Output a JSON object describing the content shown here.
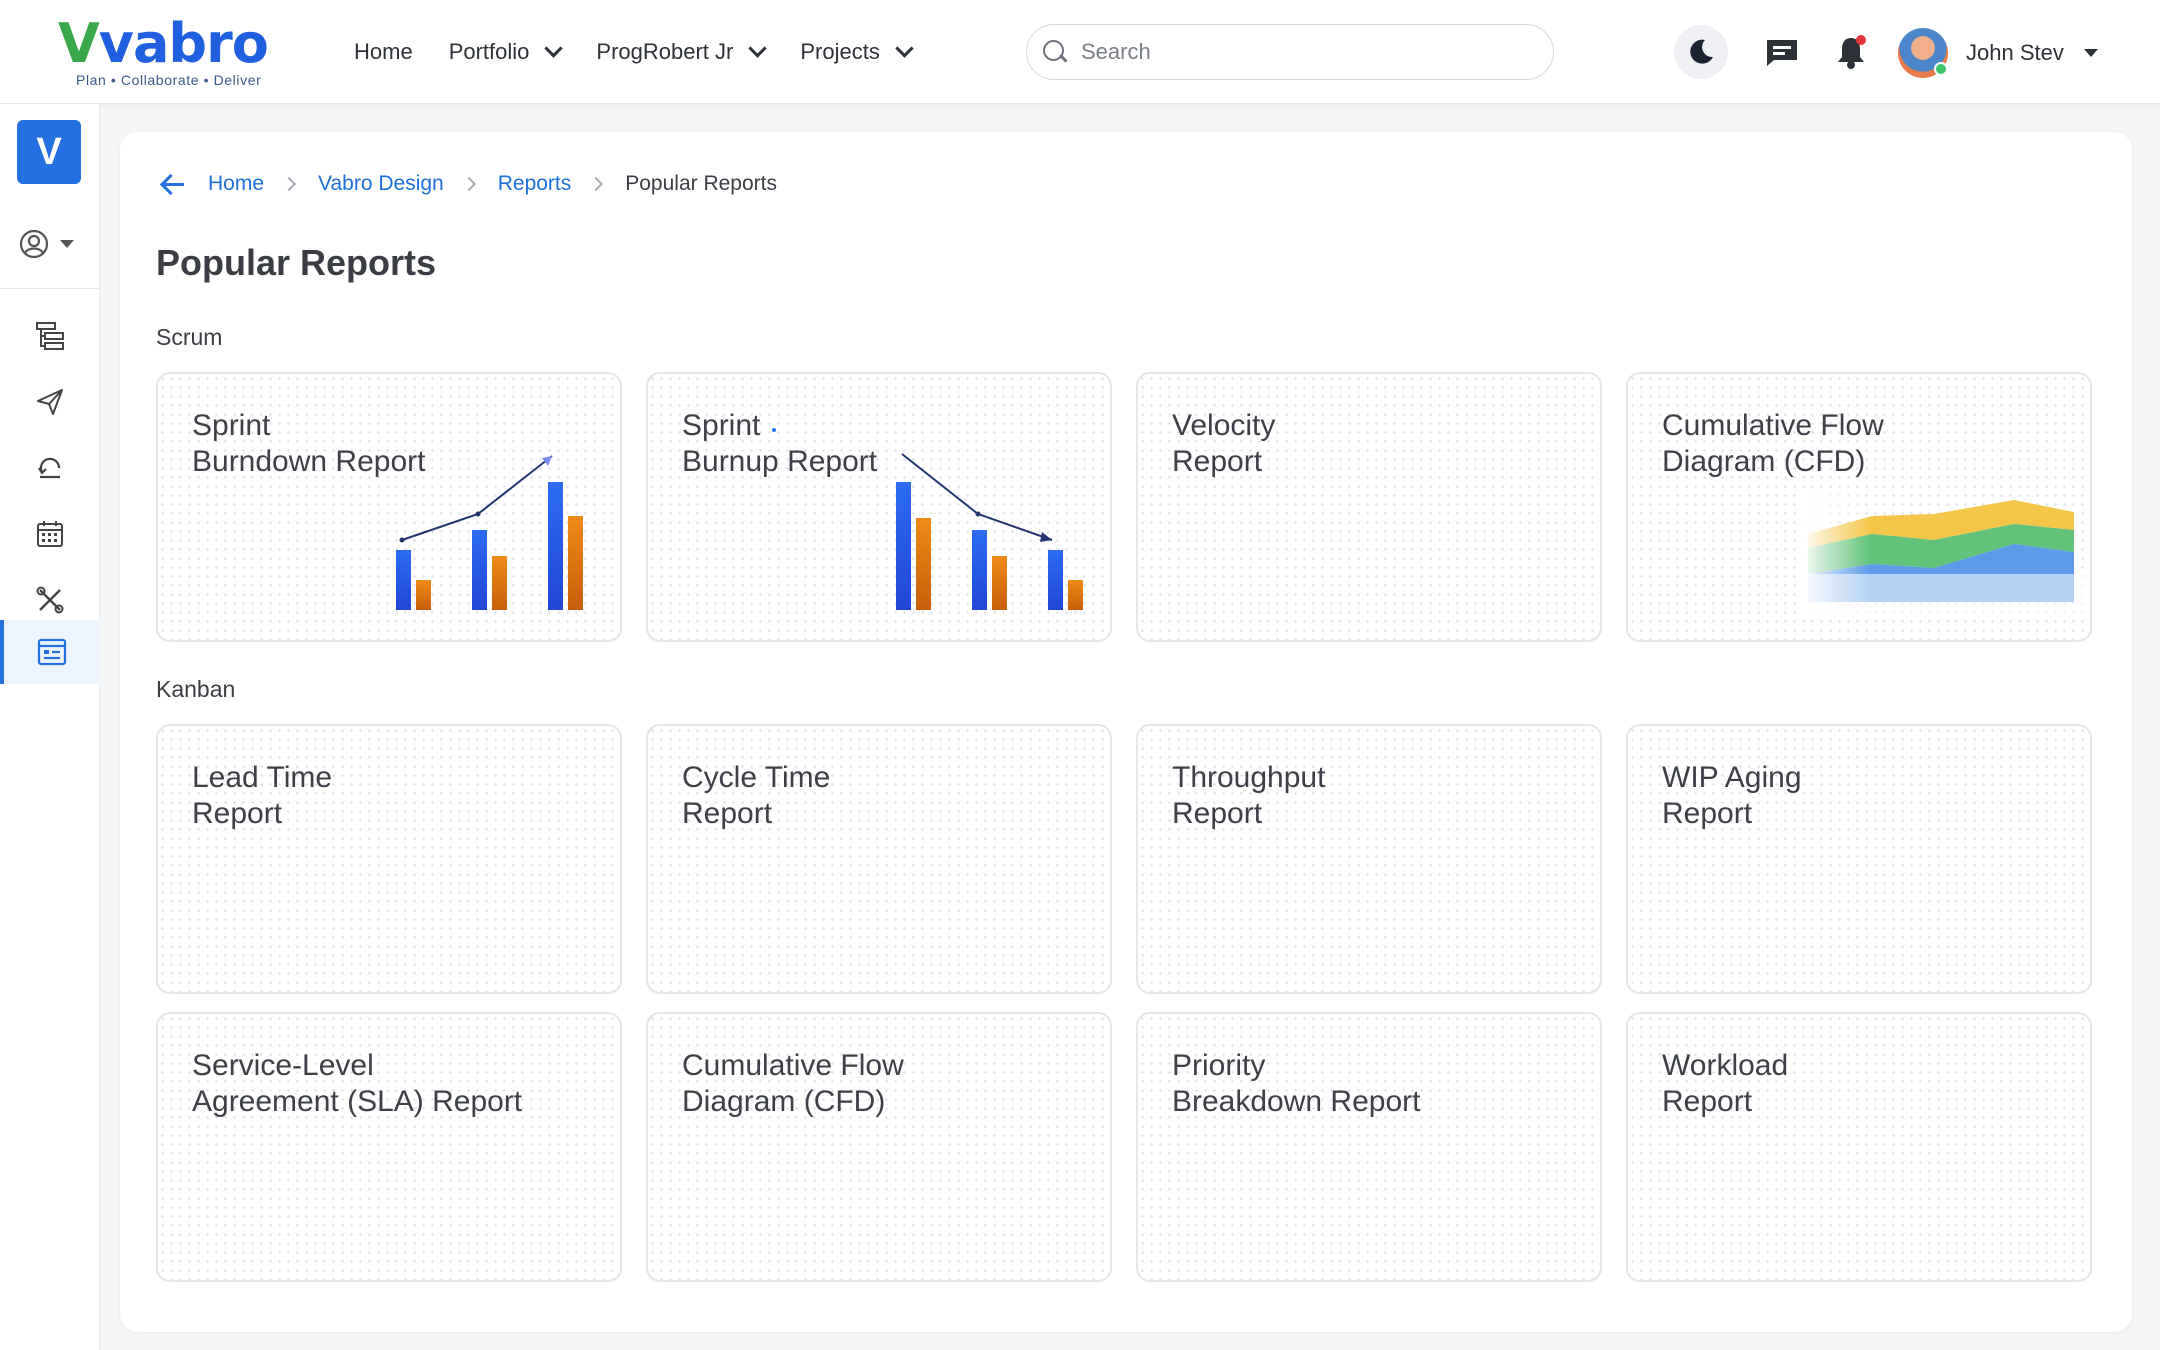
{
  "brand": {
    "logo_text_v": "V",
    "logo_text_rest": "vabro",
    "tagline": "Plan • Collaborate • Deliver"
  },
  "nav": {
    "items": [
      {
        "label": "Home",
        "dropdown": false
      },
      {
        "label": "Portfolio",
        "dropdown": true
      },
      {
        "label": "ProgRobert Jr",
        "dropdown": true
      },
      {
        "label": "Projects",
        "dropdown": true
      }
    ]
  },
  "search": {
    "placeholder": "Search",
    "value": ""
  },
  "user": {
    "name": "John Stev",
    "status": "online"
  },
  "sidebar": {
    "workspace_initial": "V",
    "items": [
      {
        "icon": "hierarchy-icon"
      },
      {
        "icon": "send-icon"
      },
      {
        "icon": "sprint-loop-icon"
      },
      {
        "icon": "calendar-icon"
      },
      {
        "icon": "tools-icon"
      },
      {
        "icon": "reports-icon",
        "active": true
      }
    ]
  },
  "breadcrumb": {
    "items": [
      "Home",
      "Vabro Design",
      "Reports"
    ],
    "current": "Popular Reports"
  },
  "page": {
    "title": "Popular Reports"
  },
  "sections": {
    "scrum": {
      "label": "Scrum",
      "cards": [
        {
          "line1": "Sprint",
          "line2": "Burndown Report"
        },
        {
          "line1": "Sprint",
          "line2": "Burnup Report"
        },
        {
          "line1": "Velocity",
          "line2": "Report"
        },
        {
          "line1": "Cumulative Flow",
          "line2": "Diagram (CFD)"
        }
      ]
    },
    "kanban": {
      "label": "Kanban",
      "cards": [
        {
          "line1": "Lead Time",
          "line2": "Report"
        },
        {
          "line1": "Cycle Time",
          "line2": "Report"
        },
        {
          "line1": "Throughput",
          "line2": "Report"
        },
        {
          "line1": "WIP Aging",
          "line2": "Report"
        },
        {
          "line1": "Service-Level",
          "line2": "Agreement (SLA) Report"
        },
        {
          "line1": "Cumulative Flow",
          "line2": "Diagram (CFD)"
        },
        {
          "line1": "Priority",
          "line2": "Breakdown Report"
        },
        {
          "line1": "Workload",
          "line2": "Report"
        }
      ]
    }
  },
  "colors": {
    "accent": "#2470e0",
    "bar_blue": "#2a62f0",
    "bar_orange": "#e0760f",
    "logo_green": "#3aa84a"
  }
}
